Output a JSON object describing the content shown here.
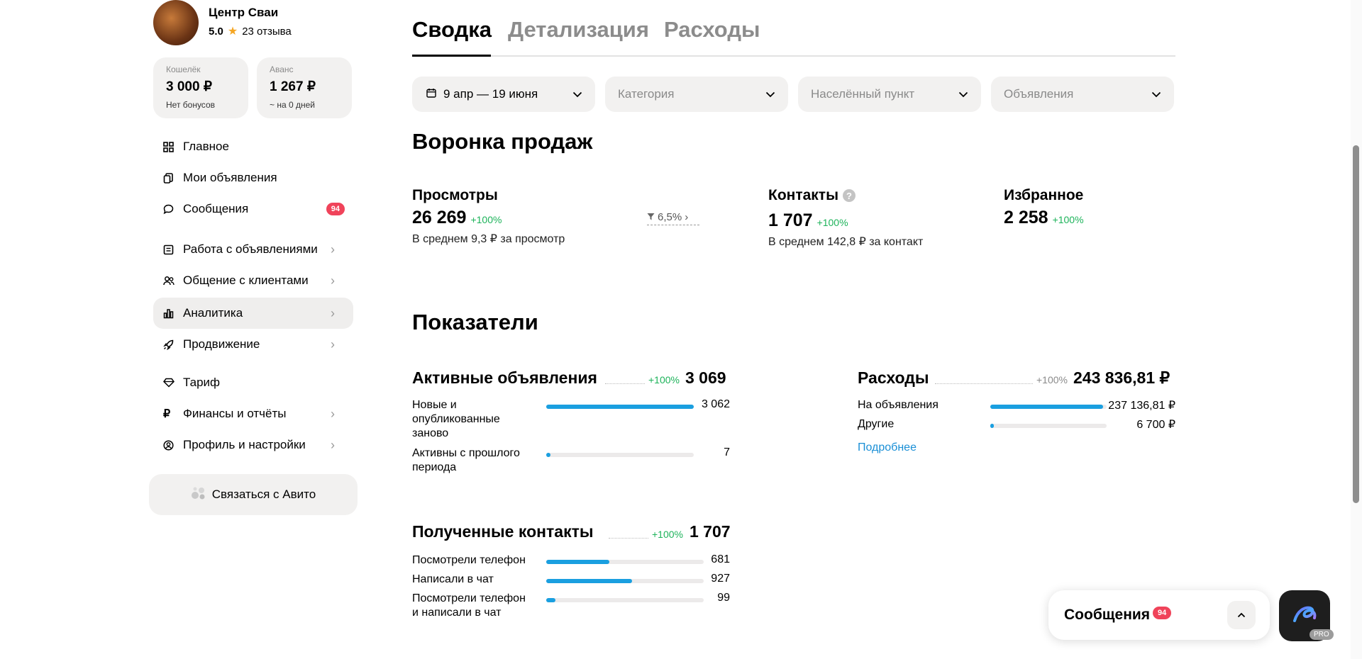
{
  "profile": {
    "name": "Центр Сваи",
    "rating": "5.0",
    "reviews": "23 отзыва"
  },
  "wallet": {
    "label": "Кошелёк",
    "value": "3 000 ₽",
    "sub": "Нет бонусов"
  },
  "advance": {
    "label": "Аванс",
    "value": "1 267 ₽",
    "sub": "~ на 0 дней"
  },
  "nav": [
    {
      "label": "Главное",
      "icon": "grid-icon"
    },
    {
      "label": "Мои объявления",
      "icon": "copy-icon"
    },
    {
      "label": "Сообщения",
      "icon": "chat-icon",
      "badge": "94"
    },
    {
      "label": "Работа с объявлениями",
      "icon": "list-icon"
    },
    {
      "label": "Общение с клиентами",
      "icon": "people-icon"
    },
    {
      "label": "Аналитика",
      "icon": "bar-chart-icon"
    },
    {
      "label": "Продвижение",
      "icon": "rocket-icon"
    },
    {
      "label": "Тариф",
      "icon": "diamond-icon"
    },
    {
      "label": "Финансы и отчёты",
      "icon": "ruble-icon"
    },
    {
      "label": "Профиль и настройки",
      "icon": "user-circle-icon"
    }
  ],
  "contact_button": "Связаться с Авито",
  "tabs": [
    "Сводка",
    "Детализация",
    "Расходы"
  ],
  "filters": {
    "date": "9 апр — 19 июня",
    "category": "Категория",
    "locality": "Населённый пункт",
    "ads": "Объявления"
  },
  "funnel": {
    "title": "Воронка продаж",
    "views": {
      "label": "Просмотры",
      "value": "26 269",
      "pct": "+100%",
      "sub": "В среднем 9,3 ₽ за просмотр"
    },
    "conversion": "6,5%",
    "contacts": {
      "label": "Контакты",
      "value": "1 707",
      "pct": "+100%",
      "sub": "В среднем 142,8 ₽ за контакт"
    },
    "favorites": {
      "label": "Избранное",
      "value": "2 258",
      "pct": "+100%"
    }
  },
  "indicators": {
    "title": "Показатели",
    "active": {
      "title": "Активные объявления",
      "pct": "+100%",
      "total": "3 069",
      "rows": [
        {
          "label": "Новые и опубликованные заново",
          "value": "3 062",
          "fill": 0.998
        },
        {
          "label": "Активны с прошлого периода",
          "value": "7",
          "fill": 0.03
        }
      ]
    },
    "expenses": {
      "title": "Расходы",
      "pct": "+100%",
      "total": "243 836,81 ₽",
      "rows": [
        {
          "label": "На объявления",
          "value": "237 136,81 ₽",
          "fill": 0.97
        },
        {
          "label": "Другие",
          "value": "6 700 ₽",
          "fill": 0.03
        }
      ],
      "link": "Подробнее"
    },
    "contacts": {
      "title": "Полученные контакты",
      "pct": "+100%",
      "total": "1 707",
      "rows": [
        {
          "label": "Посмотрели телефон",
          "value": "681",
          "fill": 0.4
        },
        {
          "label": "Написали в чат",
          "value": "927",
          "fill": 0.543
        },
        {
          "label": "Посмотрели телефон и написали в чат",
          "value": "99",
          "fill": 0.058
        }
      ]
    }
  },
  "messages_panel": {
    "title": "Сообщения",
    "badge": "94"
  },
  "pro_label": "PRO",
  "colors": {
    "accent": "#1a9fe0",
    "positive": "#1db35a",
    "badge": "#f0435a"
  }
}
